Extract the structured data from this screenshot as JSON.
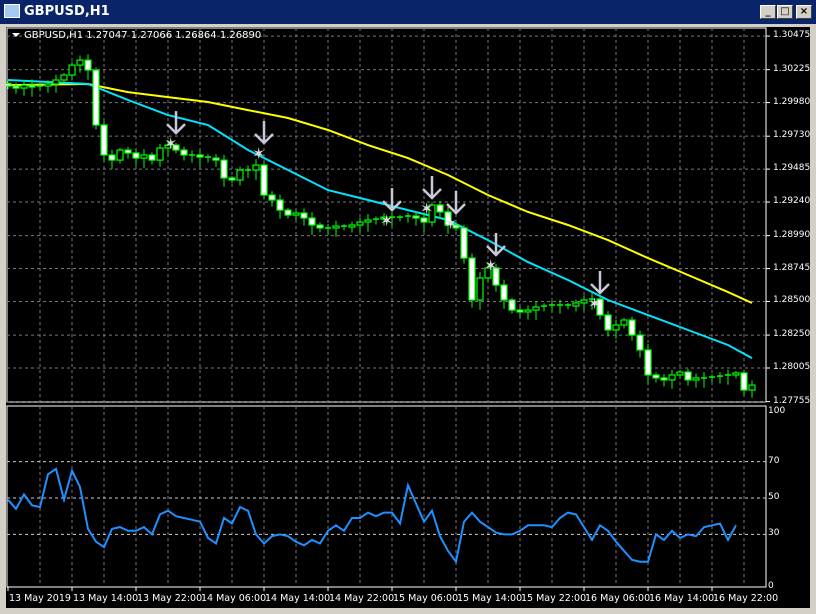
{
  "window": {
    "title": "GBPUSD,H1",
    "minimize": "_",
    "maximize": "□",
    "close": "×"
  },
  "chart_data": {
    "type": "candlestick",
    "symbol_line": "GBPUSD,H1  1.27047 1.27066 1.26864 1.26890",
    "ylim": [
      1.27752,
      1.30535
    ],
    "price_ticks": [
      "1.30475",
      "1.30225",
      "1.29980",
      "1.29730",
      "1.29485",
      "1.29240",
      "1.28990",
      "1.28745",
      "1.28500",
      "1.28250",
      "1.28005",
      "1.27755"
    ],
    "price_tick_values": [
      1.30475,
      1.30225,
      1.2998,
      1.2973,
      1.29485,
      1.2924,
      1.2899,
      1.28745,
      1.285,
      1.2825,
      1.28005,
      1.27755
    ],
    "time_ticks": [
      "13 May 2019",
      "13 May 14:00",
      "13 May 22:00",
      "14 May 06:00",
      "14 May 14:00",
      "14 May 22:00",
      "15 May 06:00",
      "15 May 14:00",
      "15 May 22:00",
      "16 May 06:00",
      "16 May 14:00",
      "16 May 22:00"
    ],
    "bars_per_time_tick": 8,
    "closes": [
      1.30103,
      1.30088,
      1.3011,
      1.30096,
      1.30103,
      1.30118,
      1.30148,
      1.30185,
      1.30259,
      1.30296,
      1.30222,
      1.29813,
      1.2959,
      1.29552,
      1.29627,
      1.29605,
      1.29567,
      1.2959,
      1.29552,
      1.29642,
      1.29664,
      1.29627,
      1.2959,
      1.2959,
      1.29575,
      1.29567,
      1.29552,
      1.29419,
      1.29404,
      1.29478,
      1.29478,
      1.29515,
      1.29292,
      1.29255,
      1.2918,
      1.29143,
      1.29158,
      1.29121,
      1.29069,
      1.29047,
      1.29047,
      1.29061,
      1.29054,
      1.29069,
      1.29091,
      1.29106,
      1.29113,
      1.29128,
      1.29121,
      1.29128,
      1.29136,
      1.29121,
      1.29091,
      1.29218,
      1.29166,
      1.29069,
      1.29047,
      1.28823,
      1.28511,
      1.28675,
      1.28749,
      1.28622,
      1.28511,
      1.28436,
      1.28422,
      1.28436,
      1.28459,
      1.28466,
      1.28474,
      1.28474,
      1.28466,
      1.28489,
      1.28511,
      1.28518,
      1.28399,
      1.28288,
      1.28325,
      1.28362,
      1.2825,
      1.28139,
      1.27953,
      1.27931,
      1.27916,
      1.27953,
      1.27975,
      1.27916,
      1.27931,
      1.27931,
      1.27938,
      1.27945,
      1.27953,
      1.27968,
      1.27841,
      1.27878
    ],
    "ma_fast": {
      "color": "#00e5ff",
      "knots": [
        [
          0,
          1.30148
        ],
        [
          10,
          1.30118
        ],
        [
          15,
          1.29999
        ],
        [
          20,
          1.29887
        ],
        [
          25,
          1.29813
        ],
        [
          30,
          1.29627
        ],
        [
          35,
          1.29478
        ],
        [
          40,
          1.29329
        ],
        [
          45,
          1.29255
        ],
        [
          50,
          1.2918
        ],
        [
          55,
          1.29106
        ],
        [
          60,
          1.28957
        ],
        [
          65,
          1.28793
        ],
        [
          70,
          1.2866
        ],
        [
          75,
          1.28511
        ],
        [
          80,
          1.28399
        ],
        [
          85,
          1.28288
        ],
        [
          90,
          1.28176
        ],
        [
          93,
          1.28079
        ]
      ]
    },
    "ma_slow": {
      "color": "#ffff00",
      "knots": [
        [
          0,
          1.3011
        ],
        [
          10,
          1.30118
        ],
        [
          15,
          1.30058
        ],
        [
          20,
          1.30021
        ],
        [
          25,
          1.29984
        ],
        [
          30,
          1.29924
        ],
        [
          35,
          1.29865
        ],
        [
          40,
          1.29776
        ],
        [
          45,
          1.29664
        ],
        [
          50,
          1.29567
        ],
        [
          55,
          1.29441
        ],
        [
          60,
          1.29292
        ],
        [
          65,
          1.29166
        ],
        [
          70,
          1.29069
        ],
        [
          75,
          1.28957
        ],
        [
          80,
          1.28823
        ],
        [
          85,
          1.28697
        ],
        [
          90,
          1.2857
        ],
        [
          93,
          1.28489
        ]
      ]
    },
    "sell_signals": [
      [
        21,
        1.29753
      ],
      [
        32,
        1.29679
      ],
      [
        48,
        1.2918
      ],
      [
        53,
        1.2927
      ],
      [
        56,
        1.29158
      ],
      [
        61,
        1.28846
      ],
      [
        74,
        1.28563
      ]
    ],
    "candle_color": "#00ff00",
    "oscillator": {
      "color": "#1e90ff",
      "ylim": [
        0,
        100
      ],
      "levels": [
        70,
        50,
        30
      ],
      "tick_labels": [
        "100",
        "70",
        "50",
        "30",
        "0"
      ],
      "tick_values": [
        100,
        70,
        50,
        30,
        0
      ],
      "values": [
        49,
        44,
        52,
        46,
        45,
        63,
        66,
        49,
        65,
        56,
        33,
        26,
        23,
        33,
        34,
        32,
        32,
        34,
        30,
        41,
        43,
        40,
        39,
        38,
        37,
        28,
        25,
        39,
        36,
        45,
        43,
        30,
        25,
        29,
        30,
        29,
        26,
        24,
        27,
        25,
        32,
        35,
        32,
        39,
        39,
        42,
        40,
        42,
        42,
        36,
        57,
        47,
        37,
        43,
        29,
        21,
        15,
        37,
        42,
        37,
        34,
        31,
        30,
        30,
        32,
        35,
        35,
        35,
        34,
        39,
        42,
        41,
        34,
        27,
        35,
        32,
        26,
        21,
        16,
        15,
        15,
        30,
        27,
        32,
        28,
        30,
        29,
        34,
        35,
        36,
        27,
        35
      ]
    }
  }
}
